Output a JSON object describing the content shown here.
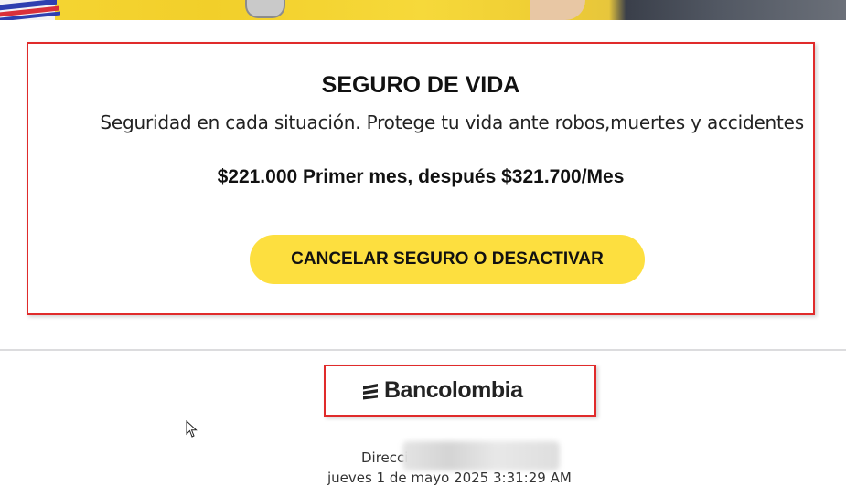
{
  "card": {
    "title": "SEGURO DE VIDA",
    "subtitle": "Seguridad en cada situación. Protege tu vida ante robos,muertes y accidentes",
    "price": "$221.000 Primer mes, después $321.700/Mes",
    "button_label": "CANCELAR SEGURO O DESACTIVAR"
  },
  "brand": {
    "name": "Bancolombia",
    "icon": "bancolombia-logo-icon"
  },
  "footer": {
    "address_label": "Direccion",
    "timestamp": "jueves 1 de mayo 2025 3:31:29 AM"
  },
  "colors": {
    "accent_button": "#fddf3f",
    "highlight_border": "#e02b2b"
  }
}
